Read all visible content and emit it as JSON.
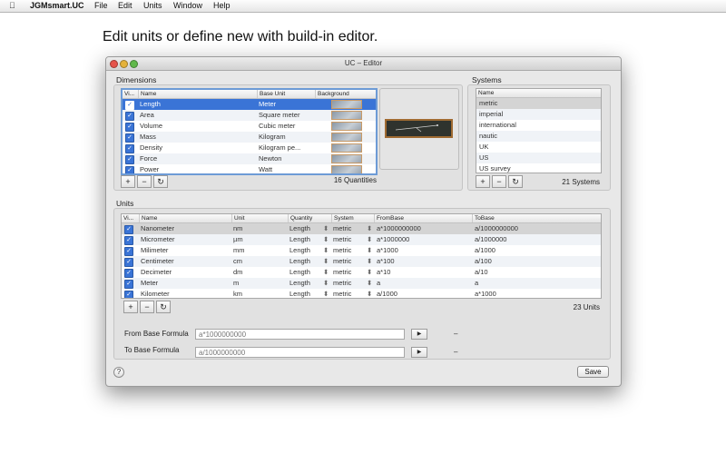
{
  "menubar": {
    "apple_icon": "apple-icon",
    "app_name": "JGMsmart.UC",
    "items": [
      "File",
      "Edit",
      "Units",
      "Window",
      "Help"
    ]
  },
  "headline": "Edit units or define new with build-in editor.",
  "window": {
    "title": "UC – Editor",
    "dimensions": {
      "label": "Dimensions",
      "columns": [
        "Vi...",
        "Name",
        "Base Unit",
        "Background"
      ],
      "rows": [
        {
          "name": "Length",
          "base_unit": "Meter",
          "selected": true
        },
        {
          "name": "Area",
          "base_unit": "Square meter"
        },
        {
          "name": "Volume",
          "base_unit": "Cubic meter"
        },
        {
          "name": "Mass",
          "base_unit": "Kilogram"
        },
        {
          "name": "Density",
          "base_unit": "Kilogram pe..."
        },
        {
          "name": "Force",
          "base_unit": "Newton"
        },
        {
          "name": "Power",
          "base_unit": "Watt"
        }
      ],
      "count": "16 Quantities"
    },
    "systems": {
      "label": "Systems",
      "columns": [
        "Name"
      ],
      "rows": [
        "metric",
        "imperial",
        "international",
        "nautic",
        "UK",
        "US",
        "US survey"
      ],
      "count": "21 Systems"
    },
    "units": {
      "label": "Units",
      "columns": [
        "Vi...",
        "Name",
        "Unit",
        "Quantity",
        "System",
        "FromBase",
        "ToBase"
      ],
      "rows": [
        {
          "name": "Nanometer",
          "unit": "nm",
          "quantity": "Length",
          "system": "metric",
          "from_base": "a*1000000000",
          "to_base": "a/1000000000"
        },
        {
          "name": "Micrometer",
          "unit": "µm",
          "quantity": "Length",
          "system": "metric",
          "from_base": "a*1000000",
          "to_base": "a/1000000"
        },
        {
          "name": "Milimeter",
          "unit": "mm",
          "quantity": "Length",
          "system": "metric",
          "from_base": "a*1000",
          "to_base": "a/1000"
        },
        {
          "name": "Centimeter",
          "unit": "cm",
          "quantity": "Length",
          "system": "metric",
          "from_base": "a*100",
          "to_base": "a/100"
        },
        {
          "name": "Decimeter",
          "unit": "dm",
          "quantity": "Length",
          "system": "metric",
          "from_base": "a*10",
          "to_base": "a/10"
        },
        {
          "name": "Meter",
          "unit": "m",
          "quantity": "Length",
          "system": "metric",
          "from_base": "a",
          "to_base": "a"
        },
        {
          "name": "Kilometer",
          "unit": "km",
          "quantity": "Length",
          "system": "metric",
          "from_base": "a/1000",
          "to_base": "a*1000"
        }
      ],
      "count": "23 Units"
    },
    "buttons": {
      "add": "+",
      "remove": "−",
      "refresh": "↻"
    },
    "from_formula": {
      "label": "From Base Formula",
      "value": "a*1000000000",
      "result": "–"
    },
    "to_formula": {
      "label": "To Base Formula",
      "value": "a/1000000000",
      "result": "–"
    },
    "play_glyph": "▶",
    "check_glyph": "✓",
    "stepper_glyph": "⬍",
    "help_label": "?",
    "save_label": "Save"
  }
}
